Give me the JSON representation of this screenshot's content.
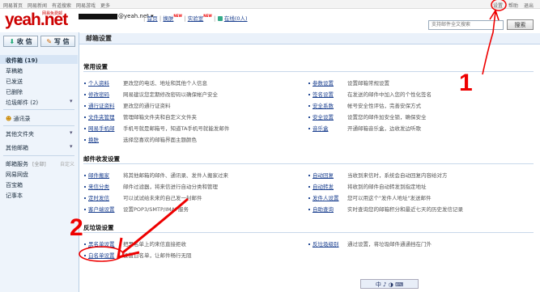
{
  "topbar": {
    "left_links": [
      "网易首页",
      "网易新闻",
      "有道搜索",
      "网易游戏",
      "更多"
    ],
    "right_links": [
      "设置",
      "帮助",
      "退出"
    ]
  },
  "header": {
    "logo": "yeah.net",
    "logo_sub": "网易免费邮",
    "email": "@yeah.net",
    "links": [
      "首页",
      "换肤",
      "实验室",
      "在线(0人)"
    ],
    "new_badge": "NEW",
    "search_placeholder": "支持邮件全文搜索",
    "search_button": "搜索"
  },
  "sidebar": {
    "receive": "收 信",
    "compose": "写 信",
    "folders": [
      {
        "label": "收件箱 (19)",
        "bold": true
      },
      {
        "label": "草稿箱",
        "bold": false
      },
      {
        "label": "已发送",
        "bold": false
      },
      {
        "label": "已删除",
        "bold": false
      },
      {
        "label": "垃圾邮件 (2)",
        "bold": false
      }
    ],
    "contacts": "通讯录",
    "other_folders": "其他文件夹",
    "other_mailboxes": "其他邮箱",
    "mail_service": "邮箱服务",
    "mail_service_tags": [
      "[全部]",
      "自定义"
    ],
    "services": [
      "网易网盘",
      "百宝箱",
      "记事本"
    ]
  },
  "main": {
    "title": "邮箱设置",
    "sections": [
      {
        "title": "常用设置",
        "left": [
          {
            "name": "个人资料",
            "desc": "更改您的电话、地址和其他个人信息"
          },
          {
            "name": "修改密码",
            "desc": "网易建议您定期修改密码以确保帐户安全"
          },
          {
            "name": "通行证资料",
            "desc": "更改您的通行证资料"
          },
          {
            "name": "文件夹管理",
            "desc": "管理邮箱文件夹和自定义文件夹"
          },
          {
            "name": "网易手机邮",
            "desc": "手机号就是邮箱号，知道TA手机号就能发邮件"
          },
          {
            "name": "换肤",
            "desc": "选择您喜欢的邮箱界面主题颜色"
          }
        ],
        "right": [
          {
            "name": "参数设置",
            "desc": "设置邮箱常规设置"
          },
          {
            "name": "签名设置",
            "desc": "在发送的邮件中加入您的个性化签名"
          },
          {
            "name": "安全系数",
            "desc": "帐号安全性评估，完善安保方式"
          },
          {
            "name": "安全设置",
            "desc": "设置您的邮件加安全锁，确保安全"
          },
          {
            "name": "音乐盒",
            "desc": "开通邮箱音乐盒，边收发边听歌"
          }
        ]
      },
      {
        "title": "邮件收发设置",
        "left": [
          {
            "name": "邮件搬家",
            "desc": "将其他邮箱的邮件、通讯录、发件人搬家过来"
          },
          {
            "name": "来信分类",
            "desc": "邮件过滤器，将来信进行自动分类和管理"
          },
          {
            "name": "定时发信",
            "desc": "可以试试给未来的自己发一封邮件"
          },
          {
            "name": "客户端设置",
            "desc": "设置POP3/SMTP/IMAP服务"
          }
        ],
        "right": [
          {
            "name": "自动回复",
            "desc": "当收到来信时，系统会自动回复内容给对方"
          },
          {
            "name": "自动转发",
            "desc": "将收到的邮件自动转发到指定地址"
          },
          {
            "name": "发件人设置",
            "desc": "您可以用这个\"发件人地址\"发送邮件"
          },
          {
            "name": "自助查询",
            "desc": "实时查询您的邮箱积分和最近七天的历史发信记录"
          }
        ]
      },
      {
        "title": "反垃圾设置",
        "left": [
          {
            "name": "黑名单设置",
            "desc": "把黑名单上的来信直接拒收"
          },
          {
            "name": "白名单设置",
            "desc": "设置白名单，让邮件畅行无阻"
          }
        ],
        "right": [
          {
            "name": "反垃圾级别",
            "desc": "通过设置，将垃圾邮件通通挡在门外"
          }
        ]
      }
    ]
  },
  "tray": "中 ♪ ◑ ⌨",
  "annotations": {
    "one": "1",
    "two": "2"
  },
  "colors": {
    "accent": "#1a3f8f",
    "annotation": "#e00000",
    "sidebar_bg": "#eef4fb"
  }
}
